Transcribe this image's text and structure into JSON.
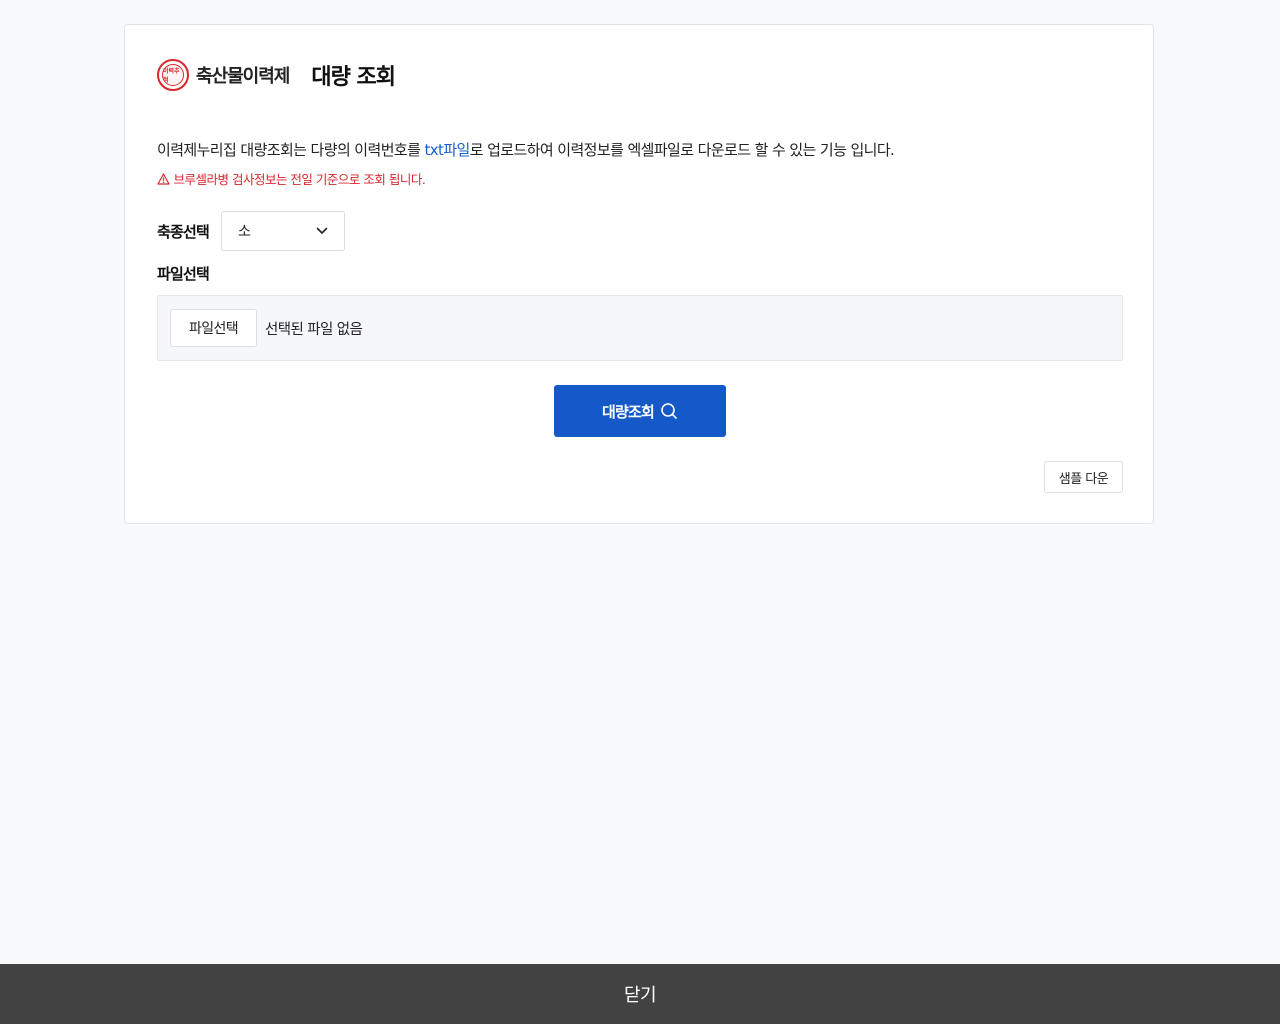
{
  "header": {
    "logo_mark_text": "이력추적",
    "logo_text": "축산물이력제",
    "title": "대량 조회"
  },
  "description": {
    "before_link": "이력제누리집 대량조회는 다량의 이력번호를 ",
    "link": "txt파일",
    "after_link": "로 업로드하여 이력정보를 엑셀파일로 다운로드 할 수 있는 기능 입니다."
  },
  "warning": {
    "icon": "warning-triangle-icon",
    "text": "브루셀라병 검사정보는 전일 기준으로 조회 됩니다."
  },
  "species": {
    "label": "축종선택",
    "selected": "소",
    "icon": "chevron-down-icon"
  },
  "file": {
    "label": "파일선택",
    "button_label": "파일선택",
    "status": "선택된 파일 없음"
  },
  "actions": {
    "search_label": "대량조회",
    "search_icon": "search-icon",
    "sample_label": "샘플 다운"
  },
  "footer": {
    "close_label": "닫기"
  },
  "colors": {
    "primary": "#1459c7",
    "link": "#1a5fc7",
    "warning": "#d8262c",
    "footer_bg": "#424242"
  }
}
